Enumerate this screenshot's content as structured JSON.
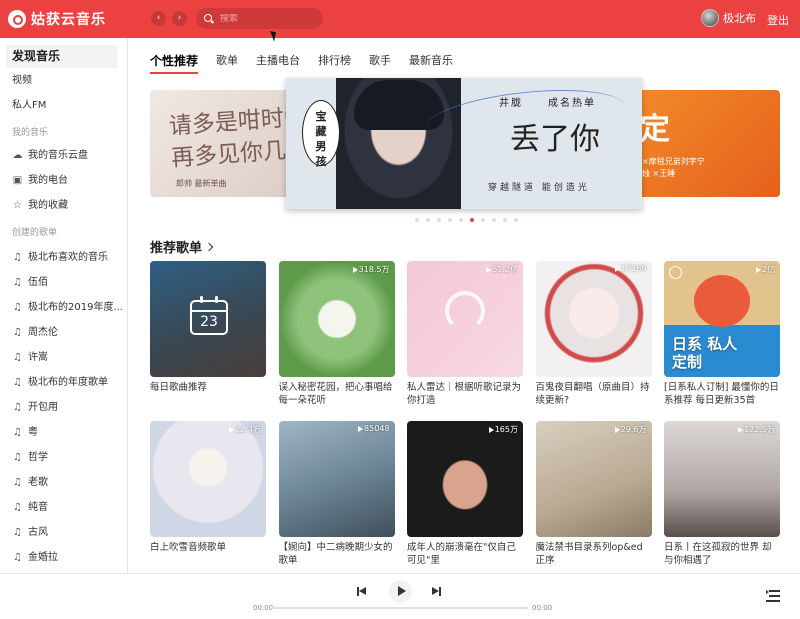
{
  "app": {
    "name": "姑获云音乐"
  },
  "header": {
    "back_glyph": "‹",
    "forward_glyph": "›",
    "search_placeholder": "搜索",
    "user_name": "极北布",
    "logout_label": "登出"
  },
  "sidebar": {
    "discover": "发现音乐",
    "top_items": [
      "视频",
      "私人FM"
    ],
    "my_music_title": "我的音乐",
    "my_music_items": [
      {
        "icon": "cloud-icon",
        "glyph": "☁",
        "label": "我的音乐云盘"
      },
      {
        "icon": "radio-icon",
        "glyph": "▣",
        "label": "我的电台"
      },
      {
        "icon": "star-icon",
        "glyph": "☆",
        "label": "我的收藏"
      }
    ],
    "created_title": "创建的歌单",
    "playlist_glyph": "♫",
    "playlists": [
      "极北布喜欢的音乐",
      "伍佰",
      "极北布的2019年度...",
      "周杰伦",
      "许嵩",
      "极北布的年度歌单",
      "开包用",
      "粤",
      "哲学",
      "老歌",
      "纯音",
      "古风",
      "金婚拉"
    ]
  },
  "tabs": [
    "个性推荐",
    "歌单",
    "主播电台",
    "排行榜",
    "歌手",
    "最新音乐"
  ],
  "banner": {
    "left": {
      "text_line1": "请多是咁时间",
      "text_line2": "再多见你几面",
      "footer": "郎帅      最新单曲"
    },
    "main": {
      "tag": [
        "宝",
        "藏",
        "男",
        "孩"
      ],
      "title1": "井胧",
      "title2": "成名热单",
      "song": "丢了你",
      "slogan": "穿越隧道  能创造光"
    },
    "right": {
      "big": "定",
      "small1": "×摩毯兄弟刘宇宁",
      "small2": "烛 ×王睡"
    }
  },
  "carousel": {
    "count": 10,
    "active_index": 5
  },
  "section": {
    "title": "推荐歌单"
  },
  "playlists": [
    {
      "title": "每日歌曲推荐",
      "plays": "",
      "cover": "daily",
      "calendar_day": "23"
    },
    {
      "title": "误入秘密花园，把心事唱给每一朵花听",
      "plays": "318.5万",
      "cover": "garden"
    },
    {
      "title": "私人雷达｜根据听歌记录为你打造",
      "plays": "51.2亿",
      "cover": "radar"
    },
    {
      "title": "百鬼夜目翻唱（原曲目）持续更新?",
      "plays": "17269",
      "cover": "anime1"
    },
    {
      "title": "[日系私人订制] 最懂你的日系推荐 每日更新35首",
      "plays": "2亿",
      "cover": "anpan",
      "overlay": "日系 私人定制"
    },
    {
      "title": "白上吹雪音频歌单",
      "plays": "22.4万",
      "cover": "fubuki"
    },
    {
      "title": "【婉向】中二病晚期少女的歌单",
      "plays": "85048",
      "cover": "wolves"
    },
    {
      "title": "成年人的崩溃毫在\"仅自己可见\"里",
      "plays": "165万",
      "cover": "portrait"
    },
    {
      "title": "魔法禁书目录系列op&ed正序",
      "plays": "29.6万",
      "cover": "index"
    },
    {
      "title": "日系丨在这孤寂的世界 却与你相遇了",
      "plays": "122.5万",
      "cover": "twins"
    }
  ],
  "player": {
    "current_time": "00:00",
    "duration": "00:00",
    "progress": 0
  }
}
